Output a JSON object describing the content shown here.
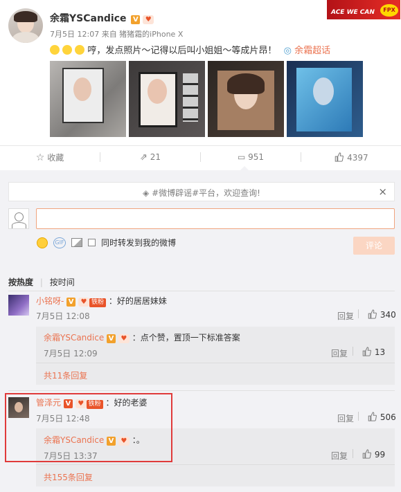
{
  "post": {
    "author": "余霜YSCandice",
    "meta": "7月5日 12:07 来自 猪猪霜的iPhone X",
    "text": "哼，发点照片～记得以后叫小姐姐～等成片昂！",
    "supertopic": "余霜超话",
    "corner_logo_top": "ACE WE CAN",
    "corner_logo_tag": "FPX"
  },
  "actions": {
    "collect": "收藏",
    "forward_count": "21",
    "comment_count": "951",
    "like_count": "4397"
  },
  "notice": {
    "text": "#微博辟谣#平台，欢迎查询!",
    "close": "×"
  },
  "composer": {
    "input_value": "",
    "repost_label": "同时转发到我的微博",
    "submit_label": "评论"
  },
  "sort": {
    "hot": "按热度",
    "time": "按时间"
  },
  "comments": [
    {
      "user": "小铭呀-",
      "fan_tag": "铁粉",
      "text": "：好的居居妹妹",
      "time": "7月5日 12:08",
      "reply": "回复",
      "likes": "340",
      "sub": {
        "user": "余霜YSCandice",
        "text": "：点个赞，置顶一下标准答案",
        "time": "7月5日 12:09",
        "reply": "回复",
        "likes": "13"
      },
      "more": "共11条回复"
    },
    {
      "user": "管泽元",
      "fan_tag": "铁粉",
      "text": "：好的老婆",
      "time": "7月5日 12:48",
      "reply": "回复",
      "likes": "506",
      "sub": {
        "user": "余霜YSCandice",
        "text": "：。",
        "time": "7月5日 13:37",
        "reply": "回复",
        "likes": "99"
      },
      "more": "共155条回复"
    }
  ],
  "colors": {
    "accent": "#eb7350",
    "highlight_box": "#e03a3a",
    "v_badge": "#f2a12c"
  }
}
